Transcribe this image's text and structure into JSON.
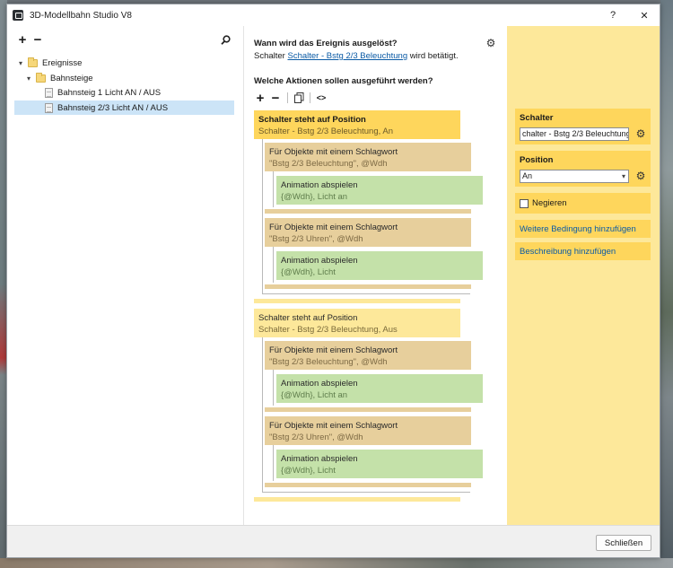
{
  "window": {
    "title": "3D-Modellbahn Studio V8",
    "help_label": "?",
    "close_label": "✕"
  },
  "left": {
    "add_label": "+",
    "remove_label": "−",
    "search_icon": "search-icon",
    "tree": [
      {
        "label": "Ereignisse",
        "expanded_glyph": "▾"
      },
      {
        "label": "Bahnsteige",
        "expanded_glyph": "▾"
      },
      {
        "label": "Bahnsteig 1 Licht AN / AUS"
      },
      {
        "label": "Bahnsteig 2/3 Licht AN / AUS"
      }
    ]
  },
  "middle": {
    "trigger_heading": "Wann wird das Ereignis ausgelöst?",
    "trigger_prefix": "Schalter",
    "trigger_link": "Schalter - Bstg 2/3 Beleuchtung",
    "trigger_suffix": "wird betätigt.",
    "actions_heading": "Welche Aktionen sollen ausgeführt werden?",
    "toolbar": {
      "add": "+",
      "remove": "−",
      "script": "<>"
    },
    "blocks": {
      "cond1_title": "Schalter steht auf Position",
      "cond1_sub": "Schalter - Bstg 2/3 Beleuchtung, An",
      "filter1_title": "Für Objekte mit einem Schlagwort",
      "filter1_sub": "\"Bstg 2/3 Beleuchtung\", @Wdh",
      "anim1_title": "Animation abspielen",
      "anim1_sub": "{@Wdh}, Licht an",
      "filter2_title": "Für Objekte mit einem Schlagwort",
      "filter2_sub": "\"Bstg 2/3 Uhren\", @Wdh",
      "anim2_title": "Animation abspielen",
      "anim2_sub": "{@Wdh}, Licht",
      "cond2_title": "Schalter steht auf Position",
      "cond2_sub": "Schalter - Bstg 2/3 Beleuchtung, Aus",
      "filter3_title": "Für Objekte mit einem Schlagwort",
      "filter3_sub": "\"Bstg 2/3 Beleuchtung\", @Wdh",
      "anim3_title": "Animation abspielen",
      "anim3_sub": "{@Wdh}, Licht an",
      "filter4_title": "Für Objekte mit einem Schlagwort",
      "filter4_sub": "\"Bstg 2/3 Uhren\", @Wdh",
      "anim4_title": "Animation abspielen",
      "anim4_sub": "{@Wdh}, Licht"
    }
  },
  "right": {
    "schalter_label": "Schalter",
    "schalter_value": "chalter - Bstg 2/3 Beleuchtung",
    "position_label": "Position",
    "position_value": "An",
    "negate_label": "Negieren",
    "add_condition_link": "Weitere Bedingung hinzufügen",
    "add_description_link": "Beschreibung hinzufügen"
  },
  "footer": {
    "close_button": "Schließen"
  },
  "colors": {
    "condition_active": "#fed65c",
    "condition": "#fde89a",
    "filter": "#e7cf9c",
    "animation": "#c4e1a9",
    "link": "#0a5aa5",
    "selection": "#cce4f7"
  }
}
